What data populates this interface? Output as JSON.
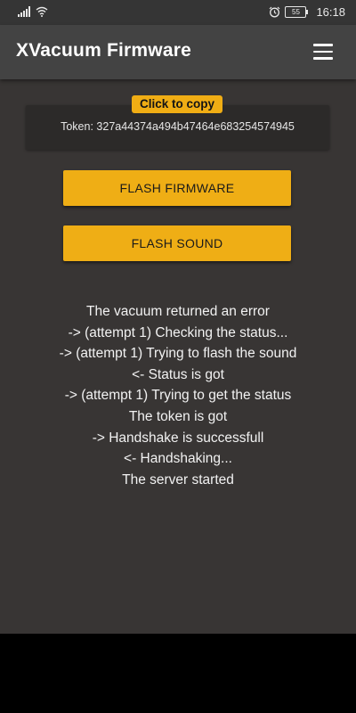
{
  "status_bar": {
    "battery_level": "55",
    "time": "16:18",
    "icons": [
      "signal-icon",
      "wifi-icon",
      "alarm-icon",
      "battery-icon"
    ]
  },
  "app_bar": {
    "title": "XVacuum Firmware",
    "menu_icon": "hamburger-menu-icon"
  },
  "token": {
    "copy_label": "Click to copy",
    "text": "Token: 327a44374a494b47464e683254574945"
  },
  "actions": {
    "flash_firmware_label": "FLASH FIRMWARE",
    "flash_sound_label": "FLASH SOUND"
  },
  "log": [
    "The vacuum returned an error",
    "-> (attempt 1) Checking the status...",
    "-> (attempt 1) Trying to flash the sound",
    "<- Status is got",
    "-> (attempt 1) Trying to get the status",
    "The token is got",
    "-> Handshake is successfull",
    "<- Handshaking...",
    "The server started"
  ],
  "colors": {
    "background": "#383534",
    "app_bar": "#434343",
    "accent": "#efae15",
    "token_card": "#2c2a29"
  }
}
